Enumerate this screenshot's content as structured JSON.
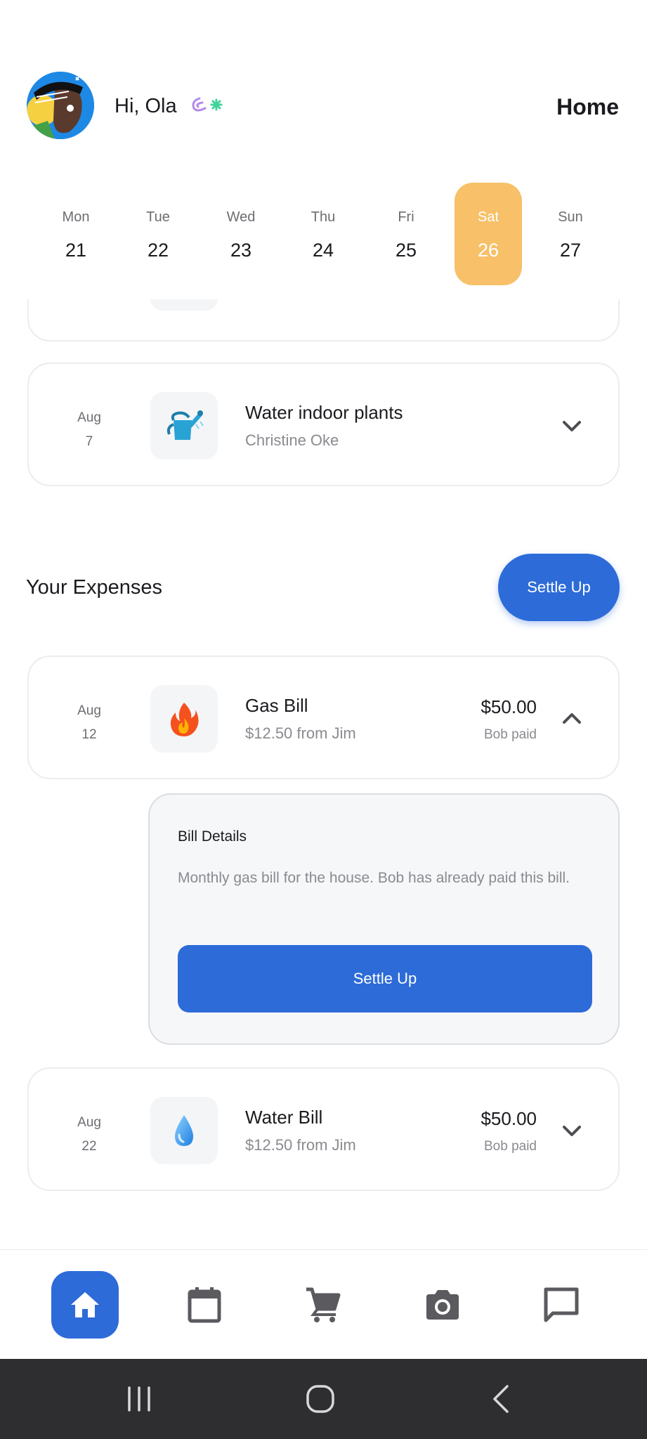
{
  "header": {
    "greeting": "Hi, Ola",
    "title": "Home",
    "avatar_icon": "user-avatar-icon"
  },
  "week": [
    {
      "name": "Mon",
      "num": "21",
      "selected": false
    },
    {
      "name": "Tue",
      "num": "22",
      "selected": false
    },
    {
      "name": "Wed",
      "num": "23",
      "selected": false
    },
    {
      "name": "Thu",
      "num": "24",
      "selected": false
    },
    {
      "name": "Fri",
      "num": "25",
      "selected": false
    },
    {
      "name": "Sat",
      "num": "26",
      "selected": true
    },
    {
      "name": "Sun",
      "num": "27",
      "selected": false
    }
  ],
  "chores": [
    {
      "month": "Aug",
      "day": "7",
      "icon": "watering-can-icon",
      "title": "Water indoor plants",
      "assignee": "Christine Oke",
      "expanded": false
    }
  ],
  "expenses_section": {
    "title": "Your Expenses",
    "settle_label": "Settle Up"
  },
  "expenses": [
    {
      "month": "Aug",
      "day": "12",
      "icon": "fire-icon",
      "title": "Gas Bill",
      "sub": "$12.50 from Jim",
      "amount": "$50.00",
      "payer": "Bob paid",
      "expanded": true
    },
    {
      "month": "Aug",
      "day": "22",
      "icon": "water-drop-icon",
      "title": "Water Bill",
      "sub": "$12.50 from Jim",
      "amount": "$50.00",
      "payer": "Bob paid",
      "expanded": false
    }
  ],
  "bill_details": {
    "heading": "Bill Details",
    "text": "Monthly gas bill for the house. Bob has already paid this bill.",
    "button": "Settle Up"
  },
  "nav": [
    {
      "icon": "home-icon",
      "active": true
    },
    {
      "icon": "calendar-icon",
      "active": false
    },
    {
      "icon": "cart-icon",
      "active": false
    },
    {
      "icon": "camera-icon",
      "active": false
    },
    {
      "icon": "chat-icon",
      "active": false
    }
  ],
  "colors": {
    "accent": "#2d6bd8",
    "selected_day": "#f7c069",
    "system_bar": "#2e2e30"
  }
}
